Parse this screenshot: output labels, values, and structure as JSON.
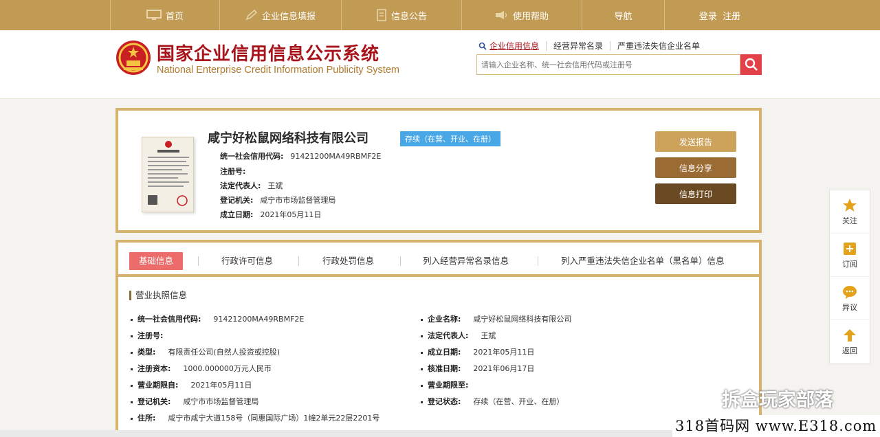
{
  "nav": {
    "items": [
      {
        "label": "首页",
        "icon": "monitor-icon"
      },
      {
        "label": "企业信息填报",
        "icon": "edit-icon"
      },
      {
        "label": "信息公告",
        "icon": "document-icon"
      },
      {
        "label": "使用帮助",
        "icon": "help-icon"
      },
      {
        "label": "导航"
      },
      {
        "label": "登录  注册"
      }
    ]
  },
  "header": {
    "title_cn": "国家企业信用信息公示系统",
    "title_en": "National Enterprise Credit Information Publicity System",
    "search_tabs": [
      "企业信用信息",
      "经营异常名录",
      "严重违法失信企业名单"
    ],
    "search_placeholder": "请输入企业名称、统一社会信用代码或注册号"
  },
  "company": {
    "name": "咸宁好松鼠网络科技有限公司",
    "status": "存续（在营、开业、在册）",
    "rows": [
      {
        "label": "统一社会信用代码:",
        "value": "91421200MA49RBMF2E"
      },
      {
        "label": "注册号:",
        "value": ""
      },
      {
        "label": "法定代表人:",
        "value": "王斌"
      },
      {
        "label": "登记机关:",
        "value": "咸宁市市场监督管理局"
      },
      {
        "label": "成立日期:",
        "value": "2021年05月11日"
      }
    ],
    "buttons": [
      "发送报告",
      "信息分享",
      "信息打印"
    ]
  },
  "tabs": [
    "基础信息",
    "行政许可信息",
    "行政处罚信息",
    "列入经营异常名录信息",
    "列入严重违法失信企业名单（黑名单）信息"
  ],
  "section": {
    "title": "营业执照信息",
    "left": [
      {
        "label": "统一社会信用代码:",
        "value": "91421200MA49RBMF2E"
      },
      {
        "label": "注册号:",
        "value": ""
      },
      {
        "label": "类型:",
        "value": "有限责任公司(自然人投资或控股)"
      },
      {
        "label": "注册资本:",
        "value": "1000.000000万元人民币"
      },
      {
        "label": "营业期限自:",
        "value": "2021年05月11日"
      },
      {
        "label": "登记机关:",
        "value": "咸宁市市场监督管理局"
      },
      {
        "label": "住所:",
        "value": "咸宁市咸宁大道158号（同惠国际广场）1幢2单元22层2201号"
      }
    ],
    "right": [
      {
        "label": "企业名称:",
        "value": "咸宁好松鼠网络科技有限公司"
      },
      {
        "label": "法定代表人:",
        "value": "王斌"
      },
      {
        "label": "成立日期:",
        "value": "2021年05月11日"
      },
      {
        "label": "核准日期:",
        "value": "2021年06月17日"
      },
      {
        "label": "营业期限至:",
        "value": ""
      },
      {
        "label": "登记状态:",
        "value": "存续（在营、开业、在册）"
      }
    ]
  },
  "sidebar": [
    "关注",
    "订阅",
    "异议",
    "返回"
  ],
  "watermark": {
    "text": "拆盒玩家部落",
    "site": "318首码网 www.E318.com"
  }
}
